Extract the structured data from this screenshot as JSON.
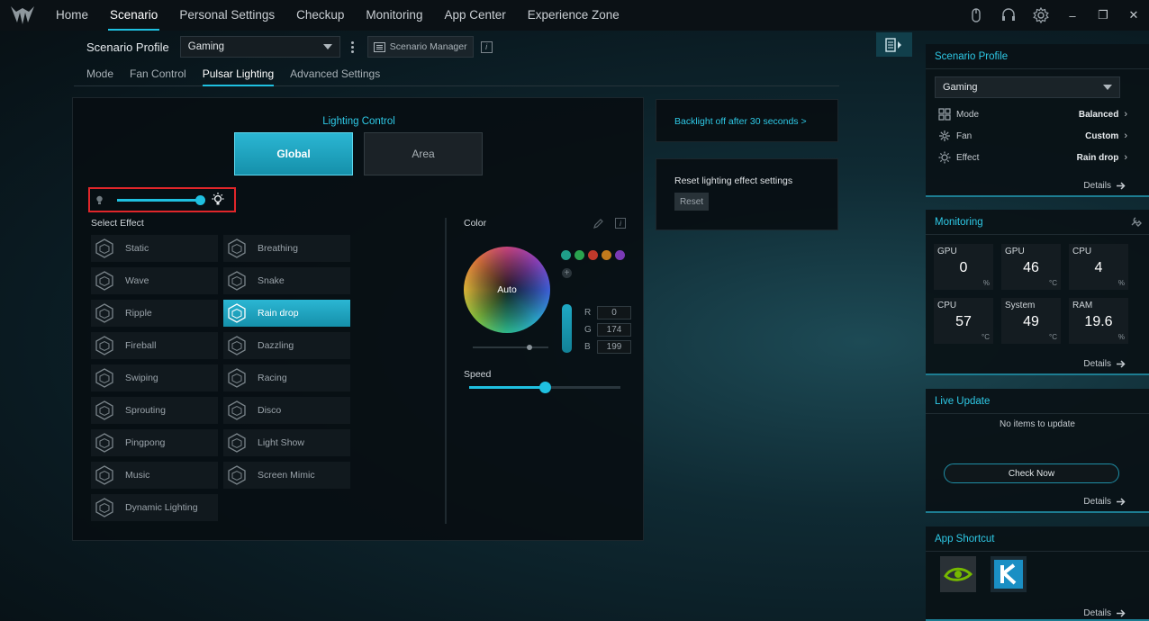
{
  "nav": {
    "items": [
      {
        "label": "Home",
        "active": false
      },
      {
        "label": "Scenario",
        "active": true
      },
      {
        "label": "Personal Settings",
        "active": false
      },
      {
        "label": "Checkup",
        "active": false
      },
      {
        "label": "Monitoring",
        "active": false
      },
      {
        "label": "App Center",
        "active": false
      },
      {
        "label": "Experience Zone",
        "active": false
      }
    ],
    "window_controls": {
      "minimize": "–",
      "restore": "❐",
      "close": "✕"
    }
  },
  "profile": {
    "label": "Scenario Profile",
    "selected": "Gaming",
    "manager_label": "Scenario Manager",
    "info": "i"
  },
  "tabs": [
    {
      "label": "Mode",
      "active": false
    },
    {
      "label": "Fan Control",
      "active": false
    },
    {
      "label": "Pulsar Lighting",
      "active": true
    },
    {
      "label": "Advanced Settings",
      "active": false
    }
  ],
  "lighting": {
    "title": "Lighting Control",
    "global_label": "Global",
    "area_label": "Area",
    "brightness_fraction": 0.97,
    "select_effect_label": "Select Effect",
    "effects": [
      {
        "label": "Static",
        "icon": "static-icon",
        "active": false
      },
      {
        "label": "Breathing",
        "icon": "breathing-icon",
        "active": false
      },
      {
        "label": "Wave",
        "icon": "wave-icon",
        "active": false
      },
      {
        "label": "Snake",
        "icon": "snake-icon",
        "active": false
      },
      {
        "label": "Ripple",
        "icon": "ripple-icon",
        "active": false
      },
      {
        "label": "Rain drop",
        "icon": "rain-drop-icon",
        "active": true
      },
      {
        "label": "Fireball",
        "icon": "fireball-icon",
        "active": false
      },
      {
        "label": "Dazzling",
        "icon": "dazzling-icon",
        "active": false
      },
      {
        "label": "Swiping",
        "icon": "swiping-icon",
        "active": false
      },
      {
        "label": "Racing",
        "icon": "racing-icon",
        "active": false
      },
      {
        "label": "Sprouting",
        "icon": "sprouting-icon",
        "active": false
      },
      {
        "label": "Disco",
        "icon": "disco-icon",
        "active": false
      },
      {
        "label": "Pingpong",
        "icon": "pingpong-icon",
        "active": false
      },
      {
        "label": "Light Show",
        "icon": "light-show-icon",
        "active": false
      },
      {
        "label": "Music",
        "icon": "music-icon",
        "active": false
      },
      {
        "label": "Screen Mimic",
        "icon": "screen-mimic-icon",
        "active": false
      },
      {
        "label": "Dynamic Lighting",
        "icon": "dynamic-lighting-icon",
        "active": false
      }
    ],
    "color_label": "Color",
    "color_info": "i",
    "wheel_label": "Auto",
    "swatches": [
      "#1f9e8a",
      "#2aa34f",
      "#c0392b",
      "#c27a1c",
      "#7b3ab5"
    ],
    "add_swatch": "+",
    "rgb": [
      {
        "k": "R",
        "v": "0"
      },
      {
        "k": "G",
        "v": "174"
      },
      {
        "k": "B",
        "v": "199"
      }
    ],
    "speed_label": "Speed",
    "speed_fraction": 0.5
  },
  "backlight": {
    "text": "Backlight off after 30 seconds >"
  },
  "reset_card": {
    "text": "Reset lighting effect settings",
    "button": "Reset"
  },
  "side": {
    "scenario": {
      "title": "Scenario Profile",
      "selected": "Gaming",
      "rows": [
        {
          "k": "Mode",
          "v": "Balanced",
          "icon": "mode-grid-icon"
        },
        {
          "k": "Fan",
          "v": "Custom",
          "icon": "fan-icon"
        },
        {
          "k": "Effect",
          "v": "Rain drop",
          "icon": "effect-sun-icon"
        }
      ],
      "details": "Details"
    },
    "monitoring": {
      "title": "Monitoring",
      "tiles": [
        {
          "label": "GPU",
          "value": "0",
          "unit": "%"
        },
        {
          "label": "GPU",
          "value": "46",
          "unit": "°C"
        },
        {
          "label": "CPU",
          "value": "4",
          "unit": "%"
        },
        {
          "label": "CPU",
          "value": "57",
          "unit": "°C"
        },
        {
          "label": "System",
          "value": "49",
          "unit": "°C"
        },
        {
          "label": "RAM",
          "value": "19.6",
          "unit": "%"
        }
      ],
      "details": "Details"
    },
    "live_update": {
      "title": "Live Update",
      "message": "No items to update",
      "button": "Check Now",
      "details": "Details"
    },
    "app_shortcut": {
      "title": "App Shortcut",
      "apps": [
        {
          "name": "nvidia-app-icon",
          "color": "#76b900"
        },
        {
          "name": "k-app-icon",
          "color": "#2aa5d6"
        }
      ],
      "details": "Details"
    }
  },
  "colors": {
    "accent": "#1fc0e0",
    "highlight": "#e0262a"
  }
}
